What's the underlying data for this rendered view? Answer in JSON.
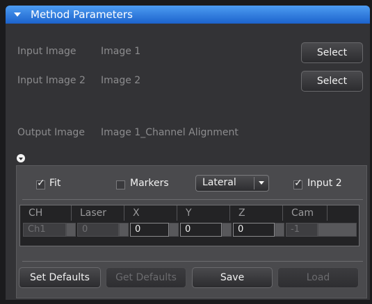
{
  "header": {
    "title": "Method Parameters"
  },
  "rows": [
    {
      "label": "Input Image",
      "value": "Image 1",
      "button": "Select"
    },
    {
      "label": "Input Image 2",
      "value": "Image 2",
      "button": "Select"
    }
  ],
  "output": {
    "label": "Output Image",
    "value": "Image 1_Channel Alignment"
  },
  "options": {
    "fit": {
      "label": "Fit",
      "checked": true
    },
    "markers": {
      "label": "Markers",
      "checked": false
    },
    "mode": {
      "selected": "Lateral"
    },
    "input2": {
      "label": "Input 2",
      "checked": true
    }
  },
  "table": {
    "columns": [
      "CH",
      "Laser",
      "X",
      "Y",
      "Z",
      "Cam"
    ],
    "row": {
      "ch": "Ch1",
      "laser": "0",
      "x": "0",
      "y": "0",
      "z": "0",
      "cam": "-1"
    }
  },
  "buttons": {
    "set_defaults": "Set Defaults",
    "get_defaults": "Get Defaults",
    "save": "Save",
    "load": "Load"
  },
  "colors": {
    "header_blue": "#2f7fe0",
    "panel": "#333336",
    "subpanel": "#4a4a4d"
  }
}
